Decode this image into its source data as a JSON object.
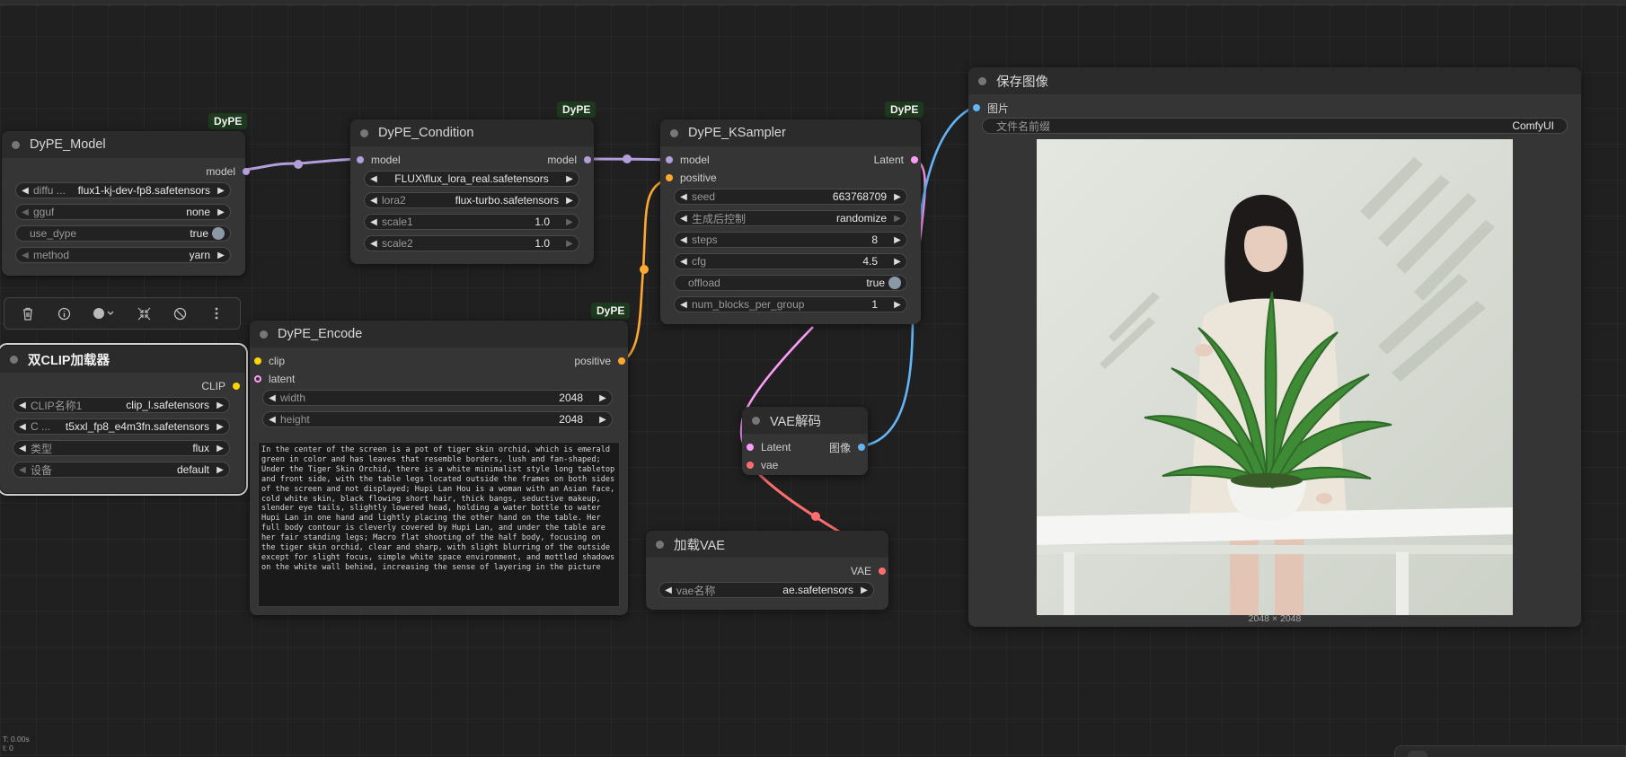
{
  "nodes": {
    "dype_model": {
      "title": "DyPE_Model",
      "badge": "DyPE",
      "output": "model",
      "widgets": [
        {
          "label": "diffu ...",
          "value": "flux1-kj-dev-fp8.safetensors"
        },
        {
          "label": "gguf",
          "value": "none"
        },
        {
          "label": "use_dype",
          "value": "true"
        },
        {
          "label": "method",
          "value": "yarn"
        }
      ]
    },
    "dype_condition": {
      "title": "DyPE_Condition",
      "badge": "DyPE",
      "input": "model",
      "output": "model",
      "widgets": [
        {
          "label": "",
          "value": "FLUX\\flux_lora_real.safetensors"
        },
        {
          "label": "lora2",
          "value": "flux-turbo.safetensors"
        },
        {
          "label": "scale1",
          "value": "1.0"
        },
        {
          "label": "scale2",
          "value": "1.0"
        }
      ]
    },
    "dype_ksampler": {
      "title": "DyPE_KSampler",
      "badge": "DyPE",
      "inputs": [
        "model",
        "positive"
      ],
      "output": "Latent",
      "widgets": [
        {
          "label": "seed",
          "value": "663768709"
        },
        {
          "label": "生成后控制",
          "value": "randomize"
        },
        {
          "label": "steps",
          "value": "8"
        },
        {
          "label": "cfg",
          "value": "4.5"
        },
        {
          "label": "offload",
          "value": "true"
        },
        {
          "label": "num_blocks_per_group",
          "value": "1"
        }
      ]
    },
    "save_image": {
      "title": "保存图像",
      "input": "图片",
      "widget": {
        "label": "文件名前缀",
        "value": "ComfyUI"
      },
      "caption": "2048 × 2048"
    },
    "dual_clip": {
      "title": "双CLIP加载器",
      "output": "CLIP",
      "widgets": [
        {
          "label": "CLIP名称1",
          "value": "clip_l.safetensors"
        },
        {
          "label": "C ...",
          "value": "t5xxl_fp8_e4m3fn.safetensors"
        },
        {
          "label": "类型",
          "value": "flux"
        },
        {
          "label": "设备",
          "value": "default"
        }
      ]
    },
    "dype_encode": {
      "title": "DyPE_Encode",
      "badge": "DyPE",
      "inputs": [
        "clip",
        "latent"
      ],
      "output": "positive",
      "widgets": [
        {
          "label": "width",
          "value": "2048"
        },
        {
          "label": "height",
          "value": "2048"
        }
      ],
      "prompt": "In the center of the screen is a pot of tiger skin orchid, which is emerald green in color and has leaves that resemble borders, lush and fan-shaped; Under the Tiger Skin Orchid, there is a white minimalist style long tabletop and front side, with the table legs located outside the frames on both sides of the screen and not displayed; Hupi Lan Hou is a woman with an Asian face, cold white skin, black flowing short hair, thick bangs, seductive makeup, slender eye tails, slightly lowered head, holding a water bottle to water Hupi Lan in one hand and lightly placing the other hand on the table. Her full body contour is cleverly covered by Hupi Lan, and under the table are her fair standing legs; Macro flat shooting of the half body, focusing on the tiger skin orchid, clear and sharp, with slight blurring of the outside except for slight focus, simple white space environment, and mottled shadows on the white wall behind, increasing the sense of layering in the picture"
    },
    "vae_decode": {
      "title": "VAE解码",
      "inputs": [
        "Latent",
        "vae"
      ],
      "output": "图像"
    },
    "vae_loader": {
      "title": "加载VAE",
      "output": "VAE",
      "widget": {
        "label": "vae名称",
        "value": "ae.safetensors"
      }
    }
  },
  "toolbar": {
    "icons": [
      "trash-icon",
      "info-icon",
      "color-icon",
      "collapse-icon",
      "bypass-icon",
      "more-icon"
    ]
  },
  "stats": {
    "line1": "T: 0.00s",
    "line2": "I: 0"
  },
  "colors": {
    "model_link": "#b39ddb",
    "clip_link": "#ffd500",
    "conditioning_link": "#ffa931",
    "latent_link": "#ff9cf9",
    "vae_link": "#ff6e6e",
    "image_link": "#64b5f6",
    "badge_bg": "#1e3a1e"
  }
}
